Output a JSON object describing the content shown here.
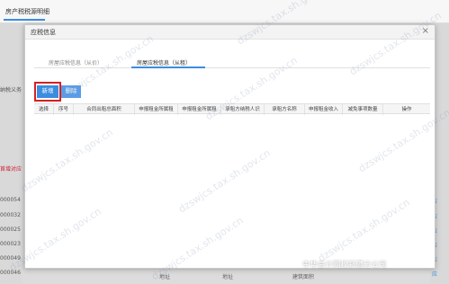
{
  "background": {
    "top_tab": "房产税税源明细",
    "left_texts": [
      "纳税义务",
      "首增对应",
      "000054",
      "000032",
      "000025",
      "000023",
      "000049",
      "000046"
    ],
    "right_texts": [
      "应",
      "应",
      "应",
      "应",
      "应",
      "应"
    ],
    "bottom_texts": [
      "地址",
      "地址",
      "建筑面积"
    ]
  },
  "modal": {
    "title": "应税信息",
    "close": "×",
    "tabs": [
      "房屋应税信息（从价）",
      "房屋应税信息（从租）"
    ],
    "buttons": {
      "add": "新增",
      "delete": "删除"
    },
    "columns": [
      "选择",
      "序号",
      "合同出租总面积",
      "申报租金所属租",
      "申报租金所属租",
      "承租方纳税人识",
      "承租方名称",
      "申报租金收入",
      "减免事项数量",
      "操作"
    ]
  },
  "watermark": "dzswjcs.tax.sh.gov.cn",
  "footer_watermark": "中华会计网校新疆分公司"
}
